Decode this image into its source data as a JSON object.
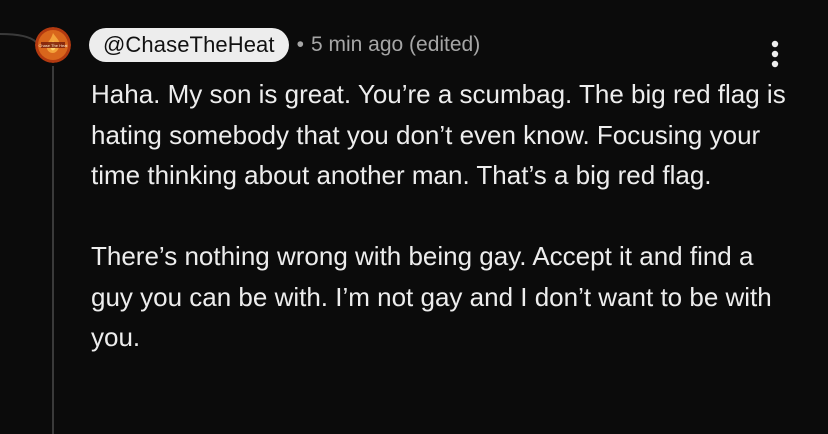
{
  "comment": {
    "username": "@ChaseTheHeat",
    "separator": "•",
    "timestamp": "5 min ago (edited)",
    "paragraphs": [
      "Haha. My son is great. You’re a scumbag. The big red flag is hating somebody that you don’t even know. Focusing your time thinking about another man. That’s a big red flag.",
      "There’s nothing wrong with being gay. Accept it and find a guy you can be with. I’m not gay and I don’t want to be with you."
    ],
    "avatar": {
      "icon": "avatar-logo-icon",
      "text": "Chase The Heat"
    },
    "more_icon": "vertical-ellipsis-icon"
  },
  "colors": {
    "background": "#0b0b0b",
    "text": "#ededed",
    "meta": "#a6a6a6",
    "pill": "#ededed",
    "thread_line": "#3a3a3a",
    "avatar_fill": "#c44a12"
  }
}
